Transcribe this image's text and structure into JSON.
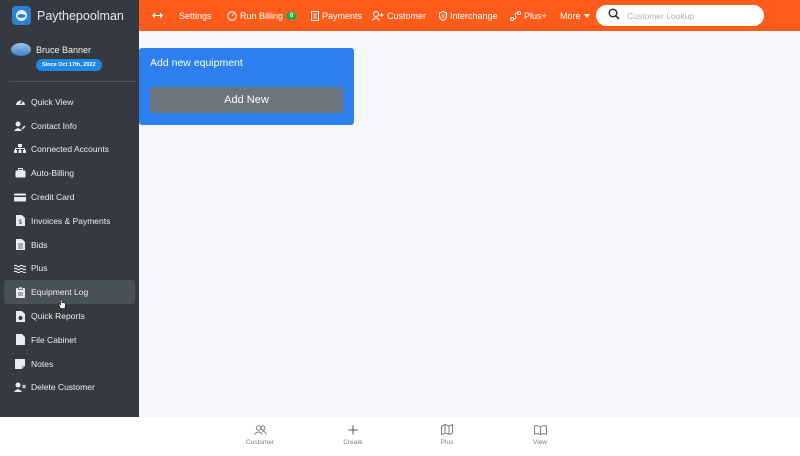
{
  "app": {
    "name": "Paythepoolman"
  },
  "user": {
    "name": "Bruce Banner",
    "since": "Since Oct 17th, 2022"
  },
  "sidebar": {
    "items": [
      {
        "label": "Quick View",
        "icon": "speedometer-icon"
      },
      {
        "label": "Contact Info",
        "icon": "user-edit-icon"
      },
      {
        "label": "Connected Accounts",
        "icon": "network-icon"
      },
      {
        "label": "Auto-Billing",
        "icon": "briefcase-icon"
      },
      {
        "label": "Credit Card",
        "icon": "credit-card-icon"
      },
      {
        "label": "Invoices & Payments",
        "icon": "invoice-icon"
      },
      {
        "label": "Bids",
        "icon": "document-icon"
      },
      {
        "label": "Plus",
        "icon": "water-waves-icon"
      },
      {
        "label": "Equipment Log",
        "icon": "clipboard-icon",
        "active": true
      },
      {
        "label": "Quick Reports",
        "icon": "report-icon"
      },
      {
        "label": "File Cabinet",
        "icon": "file-icon"
      },
      {
        "label": "Notes",
        "icon": "sticky-note-icon"
      },
      {
        "label": "Delete Customer",
        "icon": "user-remove-icon"
      }
    ]
  },
  "topnav": {
    "settings": "Settings",
    "run_billing": "Run Billing",
    "run_billing_count": "0",
    "payments": "Payments",
    "customer": "Customer",
    "interchange": "Interchange",
    "plus": "Plus+",
    "more": "More",
    "search_placeholder": "Customer Lookup"
  },
  "card": {
    "title": "Add new equipment",
    "button": "Add New"
  },
  "bottombar": {
    "items": [
      {
        "label": "Customer",
        "icon": "users-icon"
      },
      {
        "label": "Create",
        "icon": "plus-icon"
      },
      {
        "label": "Plus",
        "icon": "map-icon"
      },
      {
        "label": "View",
        "icon": "book-open-icon"
      }
    ]
  },
  "colors": {
    "topbar": "#ff5c1c",
    "sidebar": "#343a40",
    "card": "#2e7fee",
    "button": "#6c757d",
    "badge": "#1e88e5",
    "pill": "#28a745"
  }
}
